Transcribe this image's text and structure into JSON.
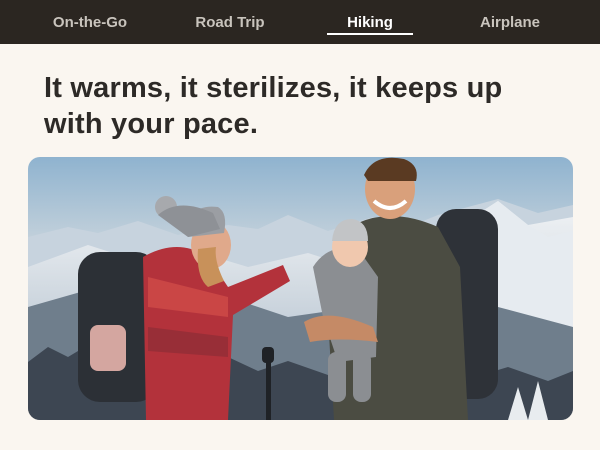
{
  "tabs": [
    {
      "label": "On-the-Go",
      "active": false
    },
    {
      "label": "Road Trip",
      "active": false
    },
    {
      "label": "Hiking",
      "active": true
    },
    {
      "label": "Airplane",
      "active": false
    }
  ],
  "headline": "It warms, it sterilizes, it keeps up with your pace.",
  "photo": {
    "icon": "family-hiking-photo"
  },
  "colors": {
    "tabbar": "#2b2621",
    "background": "#faf6f0",
    "text": "#2d2a27"
  }
}
